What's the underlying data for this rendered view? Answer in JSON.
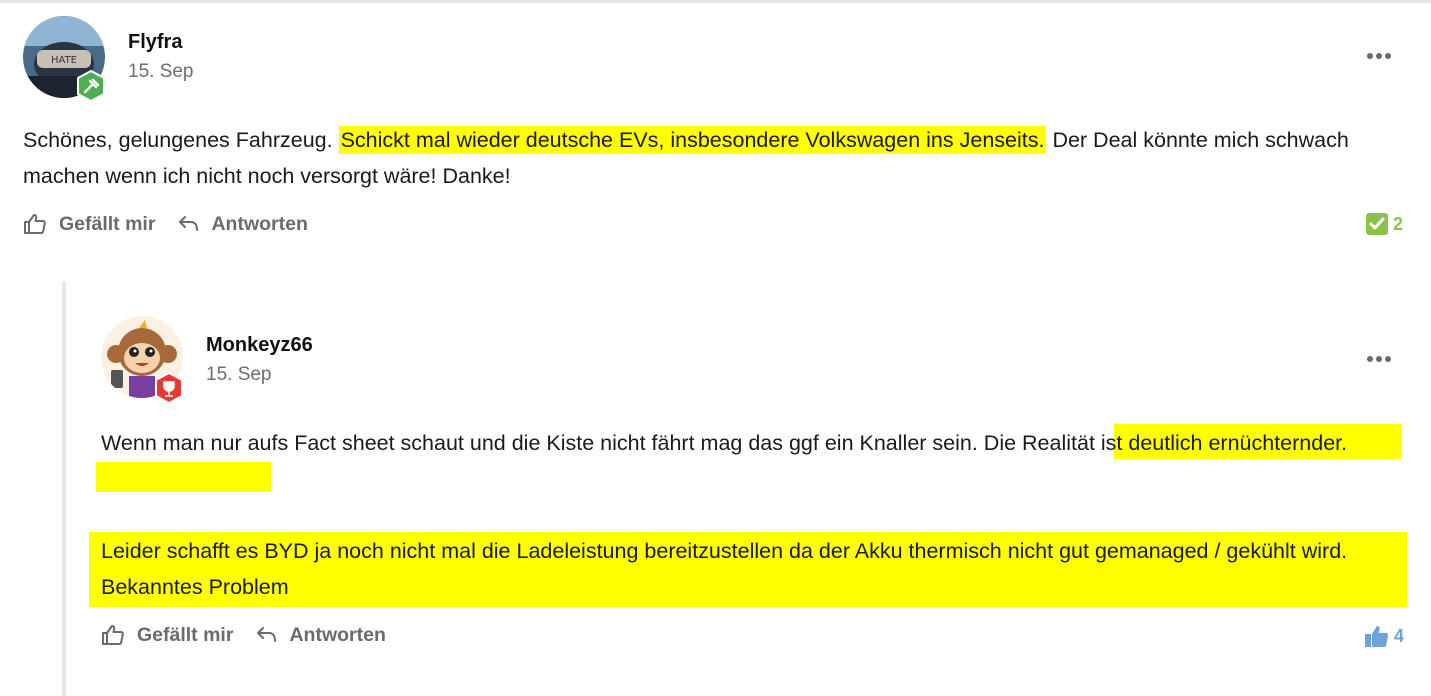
{
  "comments": [
    {
      "username": "Flyfra",
      "date": "15. Sep",
      "text_before": "Schönes, gelungenes Fahrzeug. ",
      "text_highlight": "Schickt mal wieder deutsche EVs, insbesondere Volkswagen ins Jenseits.",
      "text_after": " Der Deal könnte mich schwach machen wenn ich nicht noch versorgt wäre! Danke!",
      "like_label": "Gefällt mir",
      "reply_label": "Antworten",
      "reaction_icon": "checkmark-icon",
      "reaction_count": "2",
      "reaction_color": "#8bc34a",
      "badge_color": "#4caf50"
    },
    {
      "username": "Monkeyz66",
      "date": "15. Sep",
      "p1_before": "Wenn man nur aufs Fact sheet schaut und die Kiste nicht fährt mag das ggf ein Knaller sein. ",
      "p1_highlight": "Die Realität ist deutlich ernüchternder.",
      "p2_highlight": "Leider schafft es BYD ja noch nicht mal die Ladeleistung bereitzustellen da der Akku thermisch nicht gut gemanaged / gekühlt wird. Bekanntes Problem",
      "like_label": "Gefällt mir",
      "reply_label": "Antworten",
      "reaction_icon": "thumbs-up-icon",
      "reaction_count": "4",
      "reaction_color": "#6ea3d8",
      "badge_color": "#e53935"
    }
  ]
}
